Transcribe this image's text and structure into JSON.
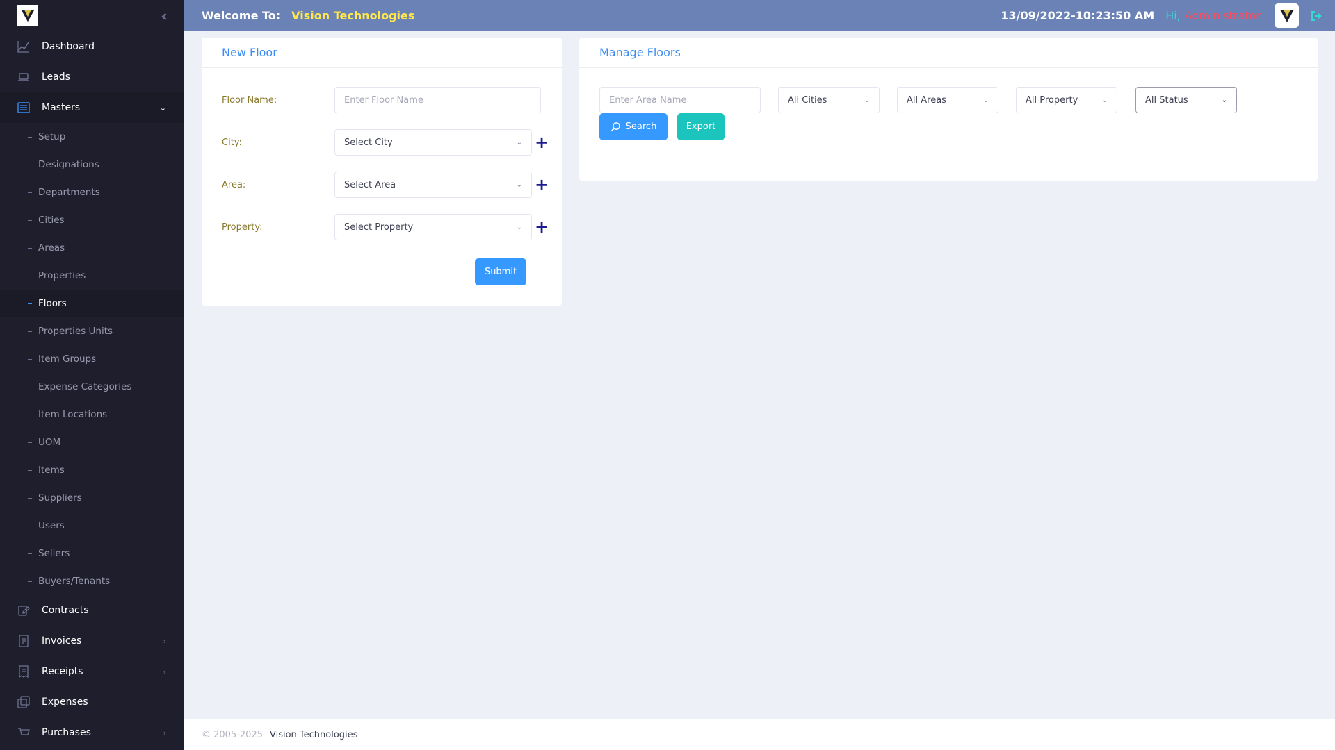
{
  "header": {
    "welcome_label": "Welcome To:",
    "company_name": "Vision Technologies",
    "datetime": "13/09/2022-10:23:50 AM",
    "greeting": "Hi,",
    "user_name": "Administrator ."
  },
  "sidebar": {
    "items": [
      {
        "label": "Dashboard",
        "icon": "chart-line-icon"
      },
      {
        "label": "Leads",
        "icon": "device-icon"
      },
      {
        "label": "Masters",
        "icon": "list-icon",
        "active": true,
        "expanded": true
      }
    ],
    "masters_sub": [
      {
        "label": "Setup"
      },
      {
        "label": "Designations"
      },
      {
        "label": "Departments"
      },
      {
        "label": "Cities"
      },
      {
        "label": "Areas"
      },
      {
        "label": "Properties"
      },
      {
        "label": "Floors",
        "active": true
      },
      {
        "label": "Properties Units"
      },
      {
        "label": "Item Groups"
      },
      {
        "label": "Expense Categories"
      },
      {
        "label": "Item Locations"
      },
      {
        "label": "UOM"
      },
      {
        "label": "Items"
      },
      {
        "label": "Suppliers"
      },
      {
        "label": "Users"
      },
      {
        "label": "Sellers"
      },
      {
        "label": "Buyers/Tenants"
      }
    ],
    "after_items": [
      {
        "label": "Contracts",
        "icon": "edit-icon"
      },
      {
        "label": "Invoices",
        "icon": "document-icon",
        "has_children": true
      },
      {
        "label": "Receipts",
        "icon": "receipt-icon",
        "has_children": true
      },
      {
        "label": "Expenses",
        "icon": "layers-icon"
      },
      {
        "label": "Purchases",
        "icon": "cart-icon",
        "has_children": true
      }
    ]
  },
  "new_floor": {
    "title": "New Floor",
    "floor_name_label": "Floor Name:",
    "floor_name_placeholder": "Enter Floor Name",
    "city_label": "City:",
    "city_value": "Select City",
    "area_label": "Area:",
    "area_value": "Select Area",
    "property_label": "Property:",
    "property_value": "Select Property",
    "submit_label": "Submit"
  },
  "manage_floors": {
    "title": "Manage Floors",
    "search_placeholder": "Enter Area Name",
    "cities_value": "All Cities",
    "areas_value": "All Areas",
    "property_value": "All Property",
    "status_value": "All Status",
    "search_label": "Search",
    "export_label": "Export"
  },
  "footer": {
    "copyright": "© 2005-2025",
    "company": "Vision Technologies"
  },
  "colors": {
    "sidebar_bg": "#1e1e2d",
    "header_bg": "#6a82b6",
    "accent": "#3699ff",
    "teal": "#1bc5bd",
    "company_yellow": "#ffe74c",
    "admin_red": "#f64e60"
  }
}
